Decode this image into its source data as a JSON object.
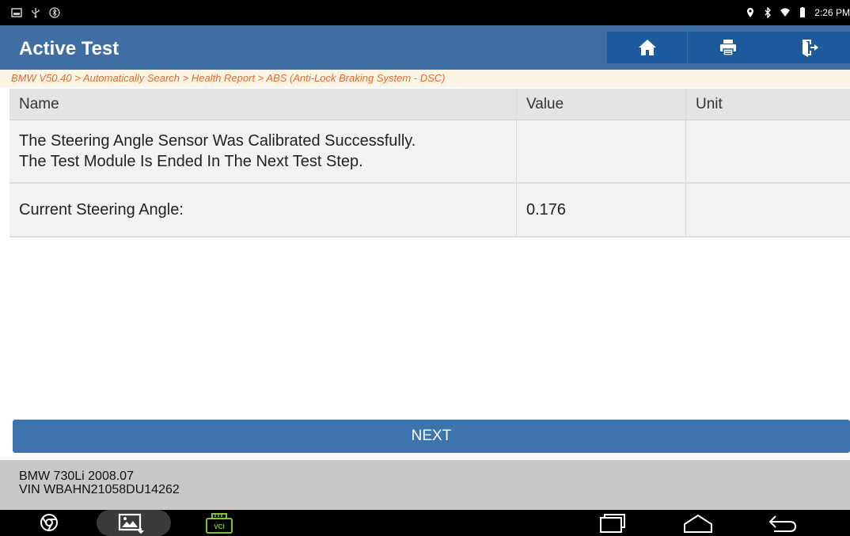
{
  "status_bar": {
    "time": "2:26 PM",
    "left_icons": [
      "gallery-icon",
      "usb-icon",
      "bluetooth-settings-icon"
    ],
    "right_icons": [
      "location-icon",
      "bluetooth-icon",
      "wifi-icon",
      "battery-icon"
    ]
  },
  "header": {
    "title": "Active Test",
    "buttons": [
      {
        "name": "home-button",
        "icon": "home-icon"
      },
      {
        "name": "print-button",
        "icon": "printer-icon"
      },
      {
        "name": "exit-button",
        "icon": "exit-icon"
      }
    ]
  },
  "breadcrumb": "BMW V50.40 > Automatically Search > Health Report > ABS (Anti-Lock Braking System - DSC)",
  "table": {
    "columns": [
      "Name",
      "Value",
      "Unit"
    ],
    "rows": [
      {
        "name": "The Steering Angle Sensor Was Calibrated Successfully.\nThe Test Module Is Ended In The Next Test Step.",
        "value": "",
        "unit": ""
      },
      {
        "name": "Current Steering Angle:",
        "value": "0.176",
        "unit": ""
      }
    ]
  },
  "next_button": "NEXT",
  "vehicle": {
    "model": "BMW 730Li 2008.07",
    "vin": "VIN WBAHN21058DU14262"
  },
  "nav_bar": {
    "left_icons": [
      "chrome-icon",
      "screenshot-icon",
      "vci-icon"
    ],
    "vci_label": "VCI",
    "right_icons": [
      "recent-apps-icon",
      "home-nav-icon",
      "back-icon"
    ]
  },
  "colors": {
    "header_bg": "#3f6ea3",
    "header_button_bg": "#1d5a9e",
    "breadcrumb_text": "#e86a30",
    "next_button_bg": "#3f73ad",
    "vci_green": "#7ec23a"
  }
}
